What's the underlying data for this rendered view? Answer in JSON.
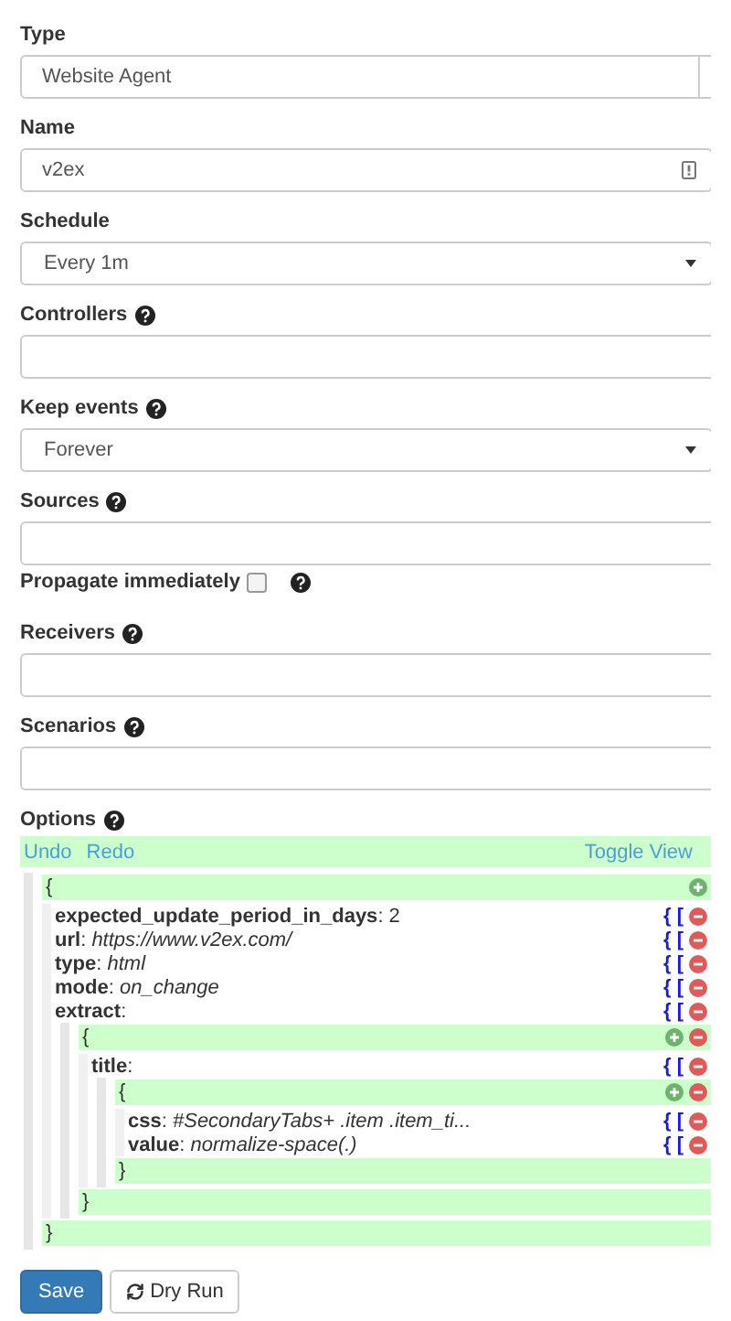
{
  "fields": [
    {
      "kind": "combo",
      "label": "Type",
      "help": false,
      "value": "Website Agent"
    },
    {
      "kind": "text",
      "label": "Name",
      "help": false,
      "value": "v2ex"
    },
    {
      "kind": "select",
      "label": "Schedule",
      "help": false,
      "value": "Every 1m"
    },
    {
      "kind": "tags",
      "label": "Controllers",
      "help": true
    },
    {
      "kind": "select",
      "label": "Keep events",
      "help": true,
      "value": "Forever"
    },
    {
      "kind": "tags",
      "label": "Sources",
      "help": true
    },
    {
      "kind": "checkbox",
      "label": "Propagate immediately",
      "help": true,
      "checked": false
    },
    {
      "kind": "tags",
      "label": "Receivers",
      "help": true
    },
    {
      "kind": "tags",
      "label": "Scenarios",
      "help": true
    }
  ],
  "options": {
    "label": "Options",
    "help": true,
    "toolbar": {
      "undo": "Undo",
      "redo": "Redo",
      "toggle": "Toggle View"
    },
    "tree": {
      "open": "{",
      "close": "}",
      "add": true,
      "remove": false,
      "entries": [
        {
          "text": "**expected_update_period_in_days**: 2",
          "kind": "value",
          "actions": "{ ["
        },
        {
          "text": "**url**: *https://www.v2ex.com/*",
          "kind": "value",
          "actions": "{ ["
        },
        {
          "text": "**type**: *html*",
          "kind": "value",
          "actions": "{ ["
        },
        {
          "text": "**mode**: *on_change*",
          "kind": "value",
          "actions": "{ ["
        },
        {
          "text": "**extract**:",
          "kind": "object",
          "actions": "{ [",
          "node": {
            "open": "{",
            "close": "}",
            "add": true,
            "remove": true,
            "entries": [
              {
                "text": "**title**:",
                "kind": "object",
                "actions": "{ [",
                "node": {
                  "open": "{",
                  "close": "}",
                  "add": true,
                  "remove": true,
                  "entries": [
                    {
                      "text": "**css**: *#SecondaryTabs+ .item .item_ti...*",
                      "kind": "value",
                      "actions": "{ ["
                    },
                    {
                      "text": "**value**: *normalize-space(.)*",
                      "kind": "value",
                      "actions": "{ ["
                    }
                  ]
                }
              }
            ]
          }
        }
      ]
    }
  },
  "buttons": {
    "save": "Save",
    "dry_run": "Dry Run"
  }
}
